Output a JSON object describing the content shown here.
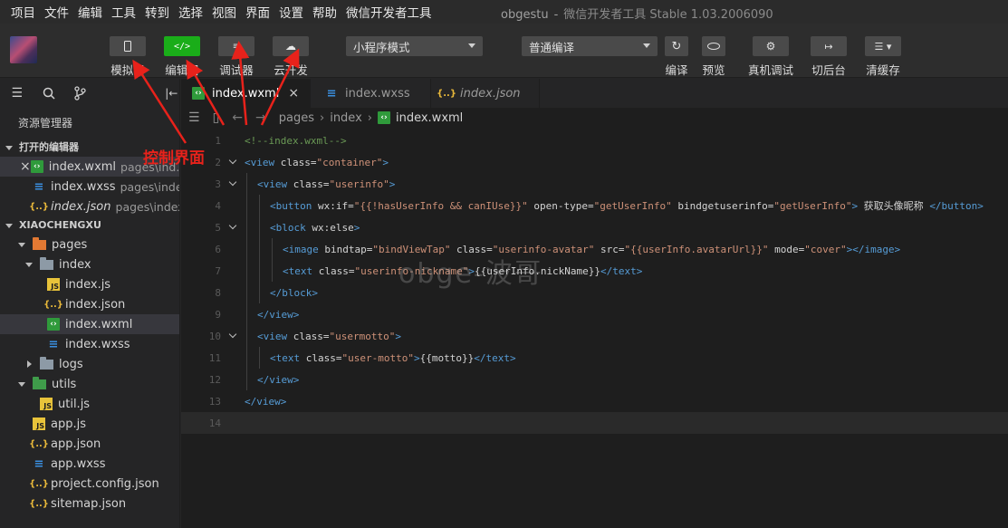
{
  "menubar": {
    "items": [
      "项目",
      "文件",
      "编辑",
      "工具",
      "转到",
      "选择",
      "视图",
      "界面",
      "设置",
      "帮助",
      "微信开发者工具"
    ],
    "title_project": "obgestu",
    "title_sep": "-",
    "title_app": "微信开发者工具 Stable 1.03.2006090"
  },
  "toolbar": {
    "tools": [
      {
        "label": "模拟器",
        "icon": "phone-icon"
      },
      {
        "label": "编辑器",
        "icon": "code-icon"
      },
      {
        "label": "调试器",
        "icon": "debug-icon"
      },
      {
        "label": "云开发",
        "icon": "cloud-icon"
      }
    ],
    "mode_select": "小程序模式",
    "compile_select": "普通编译",
    "actions": [
      {
        "label": "编译",
        "icon": "refresh-icon"
      },
      {
        "label": "预览",
        "icon": "eye-icon"
      },
      {
        "label": "真机调试",
        "icon": "bug-icon"
      },
      {
        "label": "切后台",
        "icon": "switch-icon"
      },
      {
        "label": "清缓存",
        "icon": "layers-icon"
      }
    ]
  },
  "sidebar": {
    "explorer_title": "资源管理器",
    "open_editors_title": "打开的编辑器",
    "open_editors": [
      {
        "name": "index.wxml",
        "path": "pages\\ind...",
        "type": "wxml"
      },
      {
        "name": "index.wxss",
        "path": "pages\\index",
        "type": "wxss"
      },
      {
        "name": "index.json",
        "path": "pages\\index",
        "type": "json"
      }
    ],
    "project_title": "XIAOCHENGXU",
    "tree": [
      {
        "name": "pages"
      },
      {
        "name": "index"
      },
      {
        "name": "index.js"
      },
      {
        "name": "index.json"
      },
      {
        "name": "index.wxml"
      },
      {
        "name": "index.wxss"
      },
      {
        "name": "logs"
      },
      {
        "name": "utils"
      },
      {
        "name": "util.js"
      },
      {
        "name": "app.js"
      },
      {
        "name": "app.json"
      },
      {
        "name": "app.wxss"
      },
      {
        "name": "project.config.json"
      },
      {
        "name": "sitemap.json"
      }
    ]
  },
  "editor": {
    "tabs": [
      {
        "label": "index.wxml",
        "type": "wxml",
        "active": true
      },
      {
        "label": "index.wxss",
        "type": "wxss",
        "active": false
      },
      {
        "label": "index.json",
        "type": "json",
        "active": false
      }
    ],
    "breadcrumbs": [
      "pages",
      "index",
      "index.wxml"
    ],
    "line_numbers": [
      "1",
      "2",
      "3",
      "4",
      "5",
      "6",
      "7",
      "8",
      "9",
      "10",
      "11",
      "12",
      "13",
      "14"
    ],
    "code": {
      "l1": "<!--index.wxml-->",
      "l2_a": "<view ",
      "l2_b": "class=",
      "l2_c": "\"container\"",
      "l2_d": ">",
      "l3_a": "<view ",
      "l3_b": "class=",
      "l3_c": "\"userinfo\"",
      "l3_d": ">",
      "l4_a": "<button ",
      "l4_b": "wx:if=",
      "l4_c": "\"{{!hasUserInfo && canIUse}}\"",
      "l4_d": " open-type=",
      "l4_e": "\"getUserInfo\"",
      "l4_f": " bindgetuserinfo=",
      "l4_g": "\"getUserInfo\"",
      "l4_h": ">",
      "l4_i": " 获取头像昵称 ",
      "l4_j": "</button>",
      "l5_a": "<block ",
      "l5_b": "wx:else",
      "l5_c": ">",
      "l6_a": "<image ",
      "l6_b": "bindtap=",
      "l6_c": "\"bindViewTap\"",
      "l6_d": " class=",
      "l6_e": "\"userinfo-avatar\"",
      "l6_f": " src=",
      "l6_g": "\"{{userInfo.avatarUrl}}\"",
      "l6_h": " mode=",
      "l6_i": "\"cover\"",
      "l6_j": "></image>",
      "l7_a": "<text ",
      "l7_b": "class=",
      "l7_c": "\"userinfo-nickname\"",
      "l7_d": ">",
      "l7_e": "{{userInfo.nickName}}",
      "l7_f": "</text>",
      "l8": "</block>",
      "l9": "</view>",
      "l10_a": "<view ",
      "l10_b": "class=",
      "l10_c": "\"usermotto\"",
      "l10_d": ">",
      "l11_a": "<text ",
      "l11_b": "class=",
      "l11_c": "\"user-motto\"",
      "l11_d": ">",
      "l11_e": "{{motto}}",
      "l11_f": "</text>",
      "l12": "</view>",
      "l13": "</view>"
    }
  },
  "annotation": {
    "label": "控制界面",
    "color": "#e8221b"
  },
  "watermark": "obge-波哥",
  "colors": {
    "accent_green": "#1aad19",
    "tag_blue": "#569cd6",
    "string_orange": "#ce9178",
    "comment_green": "#6a9955"
  }
}
